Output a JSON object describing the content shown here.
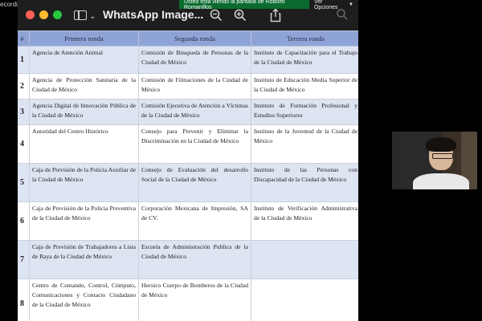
{
  "recording_label": "ecording",
  "share_banner": {
    "text": "Usted está viendo la pantalla de Rodolfo Romanillos",
    "options_label": "Ver Opciones"
  },
  "viewer": {
    "title": "WhatsApp Image...",
    "icons": [
      "sidebar-icon",
      "chevron-down-icon",
      "zoom-out-icon",
      "zoom-in-icon",
      "share-icon",
      "search-icon"
    ]
  },
  "table": {
    "headers": [
      "#",
      "Primera ronda",
      "Segunda ronda",
      "Tercera ronda"
    ],
    "rows": [
      {
        "num": "1",
        "c1": "Agencia de Atención Animal",
        "c2": "Comisión de Búsqueda de Personas de la Ciudad de México",
        "c3": "Instituto de Capacitación para el Trabajo de la Ciudad de México"
      },
      {
        "num": "2",
        "c1": "Agencia de Protección Sanitaria de la Ciudad de México",
        "c2": "Comisión de Filmaciones de la Ciudad de México",
        "c3": "Instituto de Educación Media Superior de la Ciudad de México"
      },
      {
        "num": "3",
        "c1": "Agencia Digital de Innovación Pública de la Ciudad de México",
        "c2": "Comisión Ejecutiva de Atención a Víctimas de la Ciudad de México",
        "c3": "Instituto de Formación Profesional y Estudios Superiores"
      },
      {
        "num": "4",
        "c1": "Autoridad del Centro Histórico",
        "c2": "Consejo para Prevenir y Eliminar la Discriminación en la Ciudad de México",
        "c3": "Instituto de la Juventud de la Ciudad de México"
      },
      {
        "num": "5",
        "c1": "Caja de Previsión de la Policía Auxiliar de la Ciudad de México",
        "c2": "Consejo de Evaluación del desarrollo Social de la Ciudad de México",
        "c3": "Instituto de las Personas con Discapacidad de la Ciudad de México"
      },
      {
        "num": "6",
        "c1": "Caja de Previsión de la Policía Preventiva de la Ciudad de México",
        "c2": "Corporación Mexicana de Impresión, SA de CV.",
        "c3": "Instituto de Verificación Administrativa de la Ciudad de México"
      },
      {
        "num": "7",
        "c1": "Caja de Previsión de Trabajadores a Lista de Raya de la Ciudad de México",
        "c2": "Escuela de Administración Publica de la Ciudad de México",
        "c3": ""
      },
      {
        "num": "8",
        "c1": "Centro de Comando, Control, Cómputo, Comunicaciones y Contacto Ciudadano de la Ciudad de México",
        "c2": "Heroico Cuerpo de Bomberos de la Ciudad de México",
        "c3": ""
      }
    ]
  }
}
